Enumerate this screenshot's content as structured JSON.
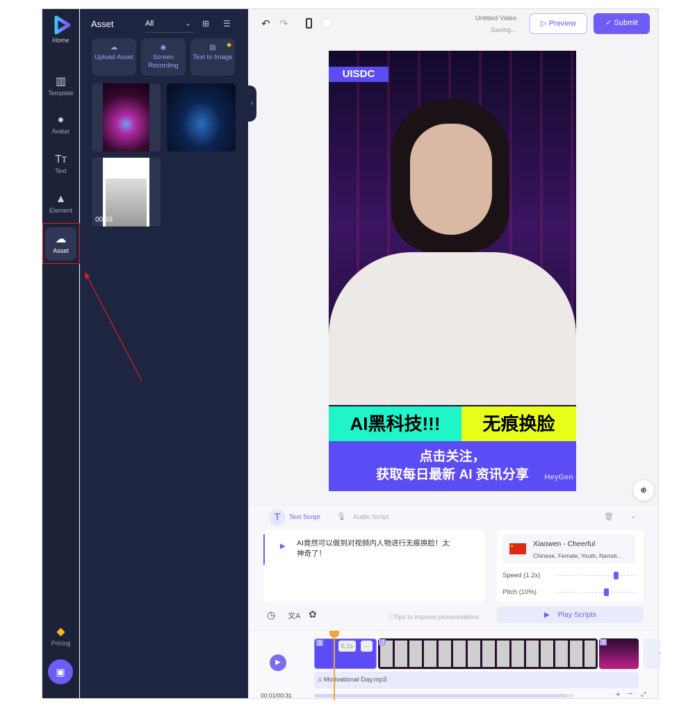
{
  "rail": {
    "home": "Home",
    "items": [
      {
        "label": "Template",
        "icon": "template-icon"
      },
      {
        "label": "Avatar",
        "icon": "avatar-icon"
      },
      {
        "label": "Text",
        "icon": "text-icon"
      },
      {
        "label": "Element",
        "icon": "element-icon"
      },
      {
        "label": "Asset",
        "icon": "upload-cloud-icon",
        "active": true
      }
    ],
    "pricing": "Pricing"
  },
  "panel": {
    "title": "Asset",
    "filter": "All",
    "quick": [
      "Upload Asset",
      "Screen Recording",
      "Text to Image"
    ],
    "thumbs": [
      {
        "kind": "image"
      },
      {
        "kind": "image"
      },
      {
        "kind": "video",
        "duration": "00:03"
      }
    ]
  },
  "top": {
    "video_title": "Untitled Video",
    "status": "Saving...",
    "preview": "Preview",
    "submit": "Submit",
    "accent": "#6e5cf6"
  },
  "video": {
    "watermark": "UISDC",
    "banner_left": "AI黑科技!!!",
    "banner_right": "无痕换脸",
    "caption1": "点击关注，",
    "caption2": "获取每日最新 AI 资讯分享",
    "logo": "HeyGen",
    "colors": {
      "left": "#1ff5c9",
      "right": "#e8ff1a",
      "bottom": "#5b4cf5"
    }
  },
  "script": {
    "tab_text": "Text Script",
    "tab_audio": "Audio Script",
    "text": "AI竟然可以做到对视频内人物进行无痕换脸！太神奇了！",
    "tips": "Tips to improve pronunciations",
    "voice_name": "Xiaowen - Cheerful",
    "voice_desc": "Chinese, Female, Youth, Narrati...",
    "speed": "Speed (1.2x)",
    "speed_value": 0.72,
    "pitch": "Pitch (10%)",
    "pitch_value": 0.6,
    "play": "Play Scripts"
  },
  "timeline": {
    "scenes": [
      "1",
      "2",
      "3"
    ],
    "duration_badge": "6.1s",
    "more": "···",
    "audio": "Motivational Day.mp3",
    "time": "00:01/00:31",
    "progress": 0.97
  }
}
